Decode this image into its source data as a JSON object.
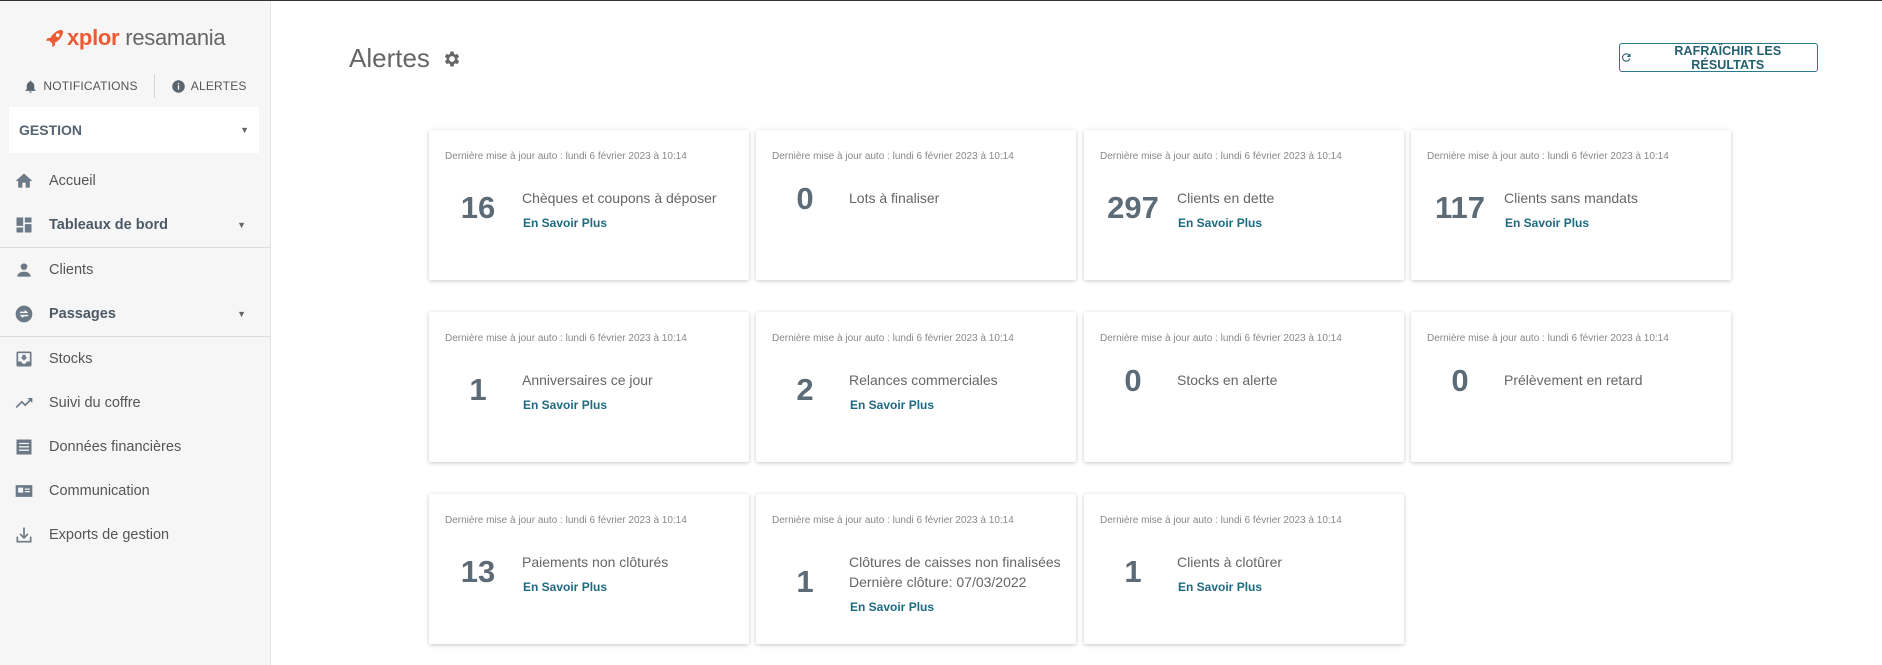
{
  "logo": {
    "brand": "xplor",
    "product": "resamania"
  },
  "topnav": {
    "notifications": "NOTIFICATIONS",
    "alerts": "ALERTES"
  },
  "section": {
    "label": "GESTION"
  },
  "menu": [
    {
      "label": "Accueil",
      "icon": "home-icon"
    },
    {
      "label": "Tableaux de bord",
      "icon": "dashboard-icon"
    },
    {
      "label": "Clients",
      "icon": "person-icon"
    },
    {
      "label": "Passages",
      "icon": "swap-icon"
    },
    {
      "label": "Stocks",
      "icon": "inbox-icon"
    },
    {
      "label": "Suivi du coffre",
      "icon": "trending-up-icon"
    },
    {
      "label": "Données financières",
      "icon": "list-icon"
    },
    {
      "label": "Communication",
      "icon": "contact-card-icon"
    },
    {
      "label": "Exports de gestion",
      "icon": "download-icon"
    }
  ],
  "page": {
    "title": "Alertes",
    "refresh_label": "RAFRAÎCHIR LES RÉSULTATS"
  },
  "cards": [
    {
      "updated": "Dernière mise à jour auto : lundi 6 février 2023 à 10:14",
      "count": "16",
      "label": "Chèques et coupons à déposer",
      "label2": "",
      "link": "En Savoir Plus"
    },
    {
      "updated": "Dernière mise à jour auto : lundi 6 février 2023 à 10:14",
      "count": "0",
      "label": "Lots à finaliser",
      "label2": "",
      "link": ""
    },
    {
      "updated": "Dernière mise à jour auto : lundi 6 février 2023 à 10:14",
      "count": "297",
      "label": "Clients en dette",
      "label2": "",
      "link": "En Savoir Plus"
    },
    {
      "updated": "Dernière mise à jour auto : lundi 6 février 2023 à 10:14",
      "count": "117",
      "label": "Clients sans mandats",
      "label2": "",
      "link": "En Savoir Plus"
    },
    {
      "updated": "Dernière mise à jour auto : lundi 6 février 2023 à 10:14",
      "count": "1",
      "label": "Anniversaires ce jour",
      "label2": "",
      "link": "En Savoir Plus"
    },
    {
      "updated": "Dernière mise à jour auto : lundi 6 février 2023 à 10:14",
      "count": "2",
      "label": "Relances commerciales",
      "label2": "",
      "link": "En Savoir Plus"
    },
    {
      "updated": "Dernière mise à jour auto : lundi 6 février 2023 à 10:14",
      "count": "0",
      "label": "Stocks en alerte",
      "label2": "",
      "link": ""
    },
    {
      "updated": "Dernière mise à jour auto : lundi 6 février 2023 à 10:14",
      "count": "0",
      "label": "Prélèvement en retard",
      "label2": "",
      "link": ""
    },
    {
      "updated": "Dernière mise à jour auto : lundi 6 février 2023 à 10:14",
      "count": "13",
      "label": "Paiements non clôturés",
      "label2": "",
      "link": "En Savoir Plus"
    },
    {
      "updated": "Dernière mise à jour auto : lundi 6 février 2023 à 10:14",
      "count": "1",
      "label": "Clôtures de caisses non finalisées",
      "label2": "Dernière clôture: 07/03/2022",
      "link": "En Savoir Plus"
    },
    {
      "updated": "Dernière mise à jour auto : lundi 6 février 2023 à 10:14",
      "count": "1",
      "label": "Clients à clotûrer",
      "label2": "",
      "link": "En Savoir Plus"
    }
  ],
  "colors": {
    "brand": "#ee5a33",
    "accent": "#1e6a83",
    "count": "#5d6b76"
  }
}
